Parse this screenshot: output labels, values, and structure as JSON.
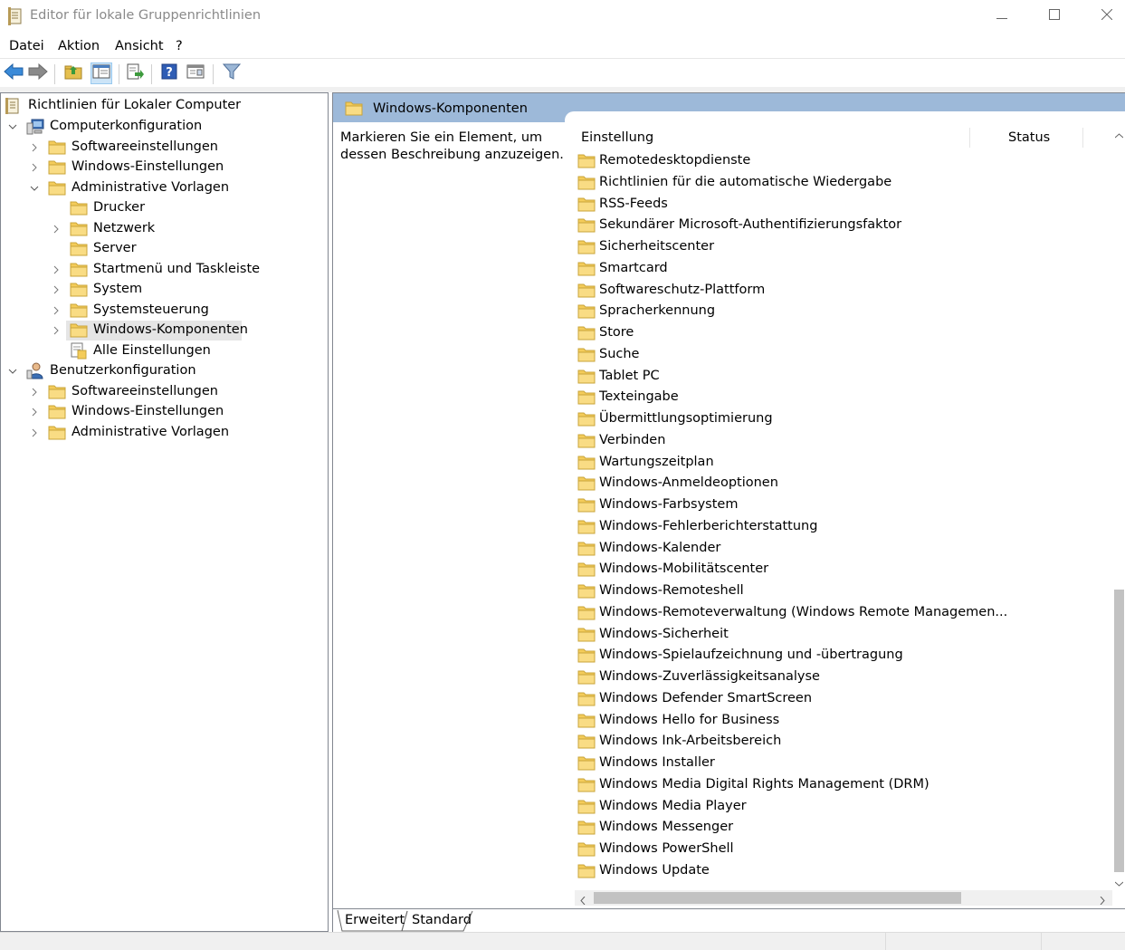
{
  "window": {
    "title": "Editor für lokale Gruppenrichtlinien"
  },
  "menu": [
    "Datei",
    "Aktion",
    "Ansicht",
    "?"
  ],
  "toolbar": {
    "icons": [
      "back-arrow-icon",
      "forward-arrow-icon",
      "up-folder-icon",
      "show-hide-tree-icon",
      "export-list-icon",
      "help-icon",
      "properties-icon",
      "filter-icon"
    ]
  },
  "tree": {
    "root": "Richtlinien für Lokaler Computer",
    "computer": "Computerkonfiguration",
    "comp_software": "Softwareeinstellungen",
    "comp_windows": "Windows-Einstellungen",
    "comp_admin": "Administrative Vorlagen",
    "admin_children": [
      "Drucker",
      "Netzwerk",
      "Server",
      "Startmenü und Taskleiste",
      "System",
      "Systemsteuerung",
      "Windows-Komponenten",
      "Alle Einstellungen"
    ],
    "user": "Benutzerkonfiguration",
    "user_software": "Softwareeinstellungen",
    "user_windows": "Windows-Einstellungen",
    "user_admin": "Administrative Vorlagen"
  },
  "details": {
    "header_title": "Windows-Komponenten",
    "description": "Markieren Sie ein Element, um dessen Beschreibung anzuzeigen.",
    "columns": [
      "Einstellung",
      "Status"
    ],
    "items": [
      "Remotedesktopdienste",
      "Richtlinien für die automatische Wiedergabe",
      "RSS-Feeds",
      "Sekundärer Microsoft-Authentifizierungsfaktor",
      "Sicherheitscenter",
      "Smartcard",
      "Softwareschutz-Plattform",
      "Spracherkennung",
      "Store",
      "Suche",
      "Tablet PC",
      "Texteingabe",
      "Übermittlungsoptimierung",
      "Verbinden",
      "Wartungszeitplan",
      "Windows-Anmeldeoptionen",
      "Windows-Farbsystem",
      "Windows-Fehlerberichterstattung",
      "Windows-Kalender",
      "Windows-Mobilitätscenter",
      "Windows-Remoteshell",
      "Windows-Remoteverwaltung (Windows Remote Managemen...",
      "Windows-Sicherheit",
      "Windows-Spielaufzeichnung und -übertragung",
      "Windows-Zuverlässigkeitsanalyse",
      "Windows Defender SmartScreen",
      "Windows Hello for Business",
      "Windows Ink-Arbeitsbereich",
      "Windows Installer",
      "Windows Media Digital Rights Management (DRM)",
      "Windows Media Player",
      "Windows Messenger",
      "Windows PowerShell",
      "Windows Update"
    ],
    "tabs": [
      "Erweitert",
      "Standard"
    ]
  },
  "colors": {
    "header_band": "#9db9d9",
    "folder_yellow": "#f4cc5a",
    "selection": "#e5e5e5"
  }
}
